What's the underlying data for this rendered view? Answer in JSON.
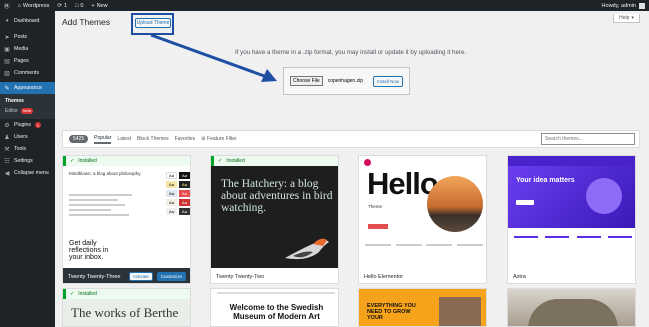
{
  "admin_bar": {
    "site_name": "Wordpress",
    "updates_count": "1",
    "comments_count": "0",
    "new_label": "New",
    "greeting": "Howdy, admin"
  },
  "sidebar": {
    "items": [
      {
        "label": "Dashboard",
        "icon": "dashboard-icon"
      },
      {
        "label": "Posts",
        "icon": "pin-icon"
      },
      {
        "label": "Media",
        "icon": "media-icon"
      },
      {
        "label": "Pages",
        "icon": "page-icon"
      },
      {
        "label": "Comments",
        "icon": "comment-icon"
      },
      {
        "label": "Appearance",
        "icon": "brush-icon"
      },
      {
        "label": "Plugins",
        "icon": "plugin-icon",
        "badge": "1"
      },
      {
        "label": "Users",
        "icon": "user-icon"
      },
      {
        "label": "Tools",
        "icon": "wrench-icon"
      },
      {
        "label": "Settings",
        "icon": "settings-icon"
      },
      {
        "label": "Collapse menu",
        "icon": "collapse-icon"
      }
    ],
    "submenu": [
      {
        "label": "Themes"
      },
      {
        "label": "Editor",
        "badge": "beta"
      }
    ]
  },
  "header": {
    "title": "Add Themes",
    "upload_button": "Upload Theme",
    "help": "Help"
  },
  "upload": {
    "description": "If you have a theme in a .zip format, you may install or update it by uploading it here.",
    "choose_file": "Choose File",
    "file_name": "copenhagen.zip",
    "install_button": "Install Now"
  },
  "filter": {
    "count": "5425",
    "tabs": [
      "Popular",
      "Latest",
      "Block Themes",
      "Favorites"
    ],
    "feature_filter": "Feature Filter",
    "search_placeholder": "Search themes..."
  },
  "themes": [
    {
      "name": "Twenty Twenty-Three",
      "installed_label": "Installed",
      "activate": "Activate",
      "customize": "Customize",
      "preview_heading": "Mindblown: a blog about philosophy.",
      "preview_big": "Get daily reflections in your inbox."
    },
    {
      "name": "Twenty Twenty-Two",
      "installed_label": "Installed",
      "preview_text": "The Hatchery: a blog about adventures in bird watching."
    },
    {
      "name": "Hello Elementor",
      "preview_text": "Hello",
      "preview_sub": "Theme"
    },
    {
      "name": "Astra",
      "preview_text": "Your idea matters"
    }
  ],
  "themes_row2": [
    {
      "installed_label": "Installed",
      "preview_text": "The works of Berthe"
    },
    {
      "preview_text": "Welcome to the Swedish Museum of Modern Art"
    },
    {
      "preview_text": "EVERYTHING YOU NEED TO GROW YOUR"
    },
    {
      "preview_text": ""
    }
  ],
  "colors": {
    "admin_dark": "#1d2327",
    "accent": "#2271b1",
    "highlight": "#1f4fa3",
    "installed_green": "#00a32a"
  }
}
